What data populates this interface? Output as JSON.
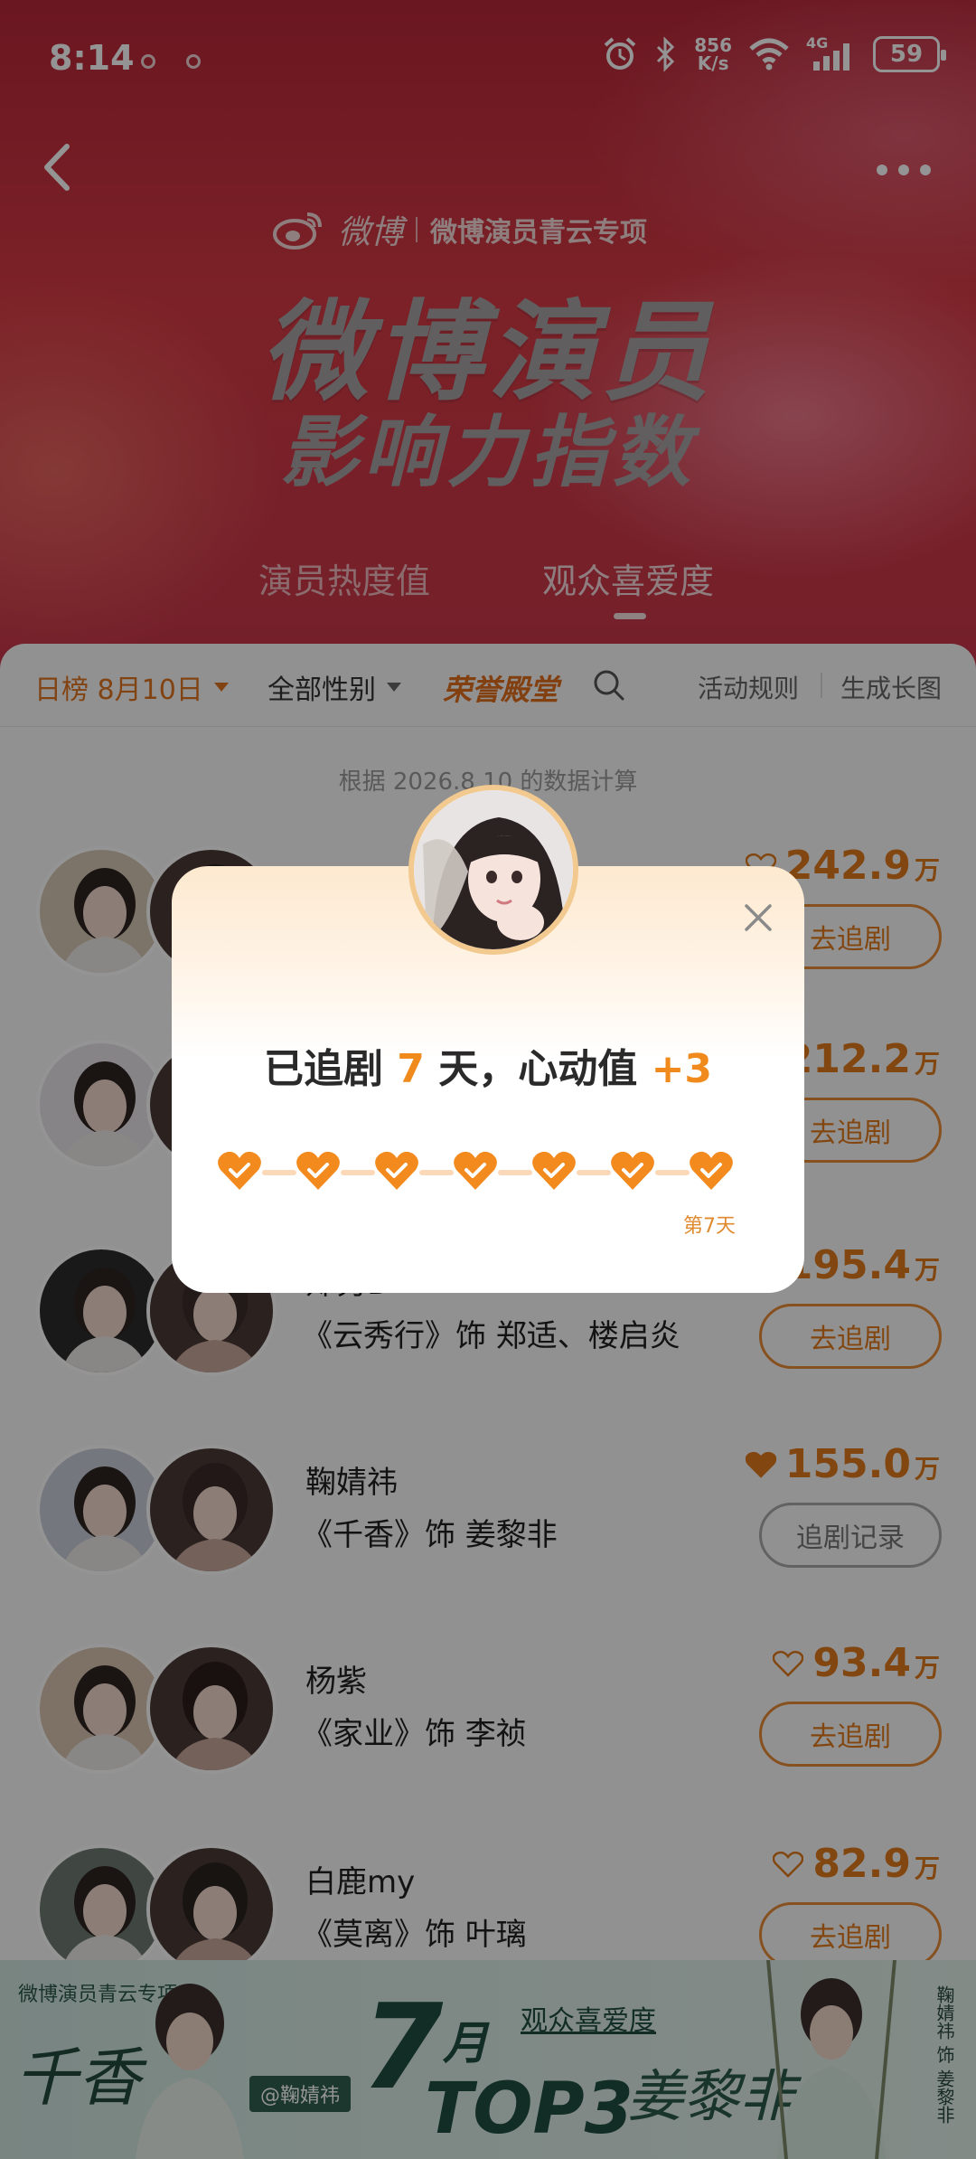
{
  "status_bar": {
    "time": "8:14",
    "net_speed_value": "856",
    "net_speed_unit": "K/s",
    "network": "4G",
    "battery": "59"
  },
  "header": {
    "brand_name": "微博",
    "brand_sub": "微博演员青云专项",
    "title_line1": "微博演员",
    "title_line2": "影响力指数",
    "tabs": [
      {
        "label": "演员热度值",
        "active": false
      },
      {
        "label": "观众喜爱度",
        "active": true
      }
    ]
  },
  "filters": {
    "date": "日榜 8月10日",
    "gender": "全部性别",
    "hall": "荣誉殿堂",
    "rules": "活动规则",
    "generate": "生成长图"
  },
  "calc_note": "根据 2026.8.10 的数据计算",
  "rows": [
    {
      "actor": "",
      "role": "",
      "score": "242.9",
      "unit": "万",
      "button": "去追剧",
      "followed": false
    },
    {
      "actor": "",
      "role": "",
      "score": "212.2",
      "unit": "万",
      "button": "去追剧",
      "followed": false
    },
    {
      "actor": "郑秀D",
      "role": "《云秀行》饰 郑适、楼启炎",
      "score": "195.4",
      "unit": "万",
      "button": "去追剧",
      "followed": false
    },
    {
      "actor": "鞠婧祎",
      "role": "《千香》饰 姜黎非",
      "score": "155.0",
      "unit": "万",
      "button": "追剧记录",
      "followed": true
    },
    {
      "actor": "杨紫",
      "role": "《家业》饰 李祯",
      "score": "93.4",
      "unit": "万",
      "button": "去追剧",
      "followed": false
    },
    {
      "actor": "白鹿my",
      "role": "《莫离》饰 叶璃",
      "score": "82.9",
      "unit": "万",
      "button": "去追剧",
      "followed": false
    }
  ],
  "banner": {
    "tag": "微博演员青云专项",
    "drama": "千香",
    "handle": "@鞠婧祎",
    "seven": "7",
    "month": "月",
    "top3": "TOP3",
    "audience": "观众喜爱度",
    "name": "姜黎非",
    "vertical": "鞠婧祎 饰 姜黎非"
  },
  "popup": {
    "msg_prefix": "已追剧",
    "days": "7",
    "msg_mid": "天，心动值",
    "bonus": "+3",
    "day_label": "第7天",
    "hearts_checked": 7
  },
  "colors": {
    "accent": "#e07a1c",
    "hero_red": "#d63a45"
  }
}
